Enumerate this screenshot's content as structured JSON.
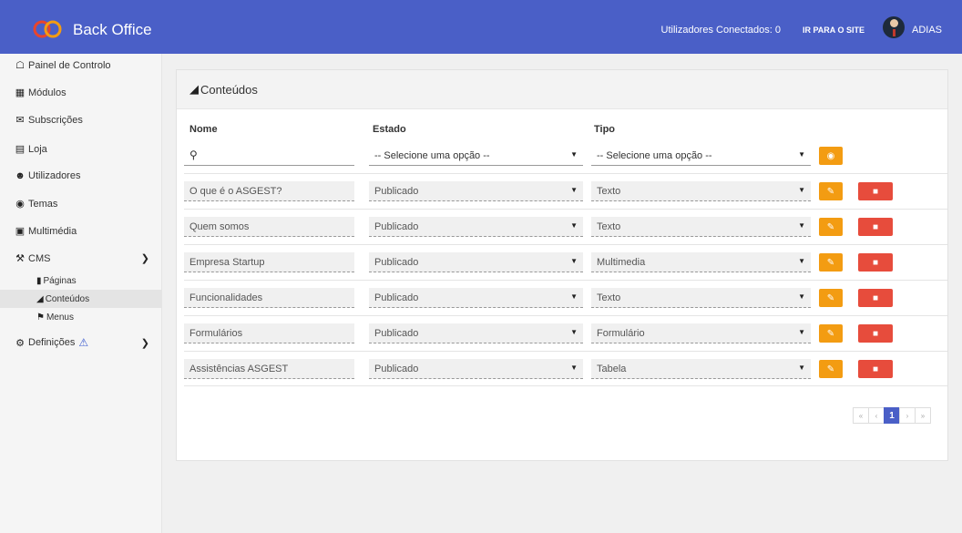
{
  "header": {
    "app_title": "Back Office",
    "connected_users": "Utilizadores Conectados: 0",
    "site_link": "IR PARA O SITE",
    "user_name": "ADIAS"
  },
  "sidebar": {
    "items": [
      {
        "label": "Painel de Controlo",
        "icon": "home-icon"
      },
      {
        "label": "Módulos",
        "icon": "th-large-icon"
      },
      {
        "label": "Subscrições",
        "icon": "envelope-icon"
      },
      {
        "label": "Loja",
        "icon": "cart-icon"
      },
      {
        "label": "Utilizadores",
        "icon": "user-icon"
      },
      {
        "label": "Temas",
        "icon": "tint-icon"
      },
      {
        "label": "Multimédia",
        "icon": "film-icon"
      },
      {
        "label": "CMS",
        "icon": "wrench-icon"
      },
      {
        "label": "Definições",
        "icon": "cog-icon"
      }
    ],
    "cms_sub": [
      {
        "label": "Páginas",
        "icon": "book-icon"
      },
      {
        "label": "Conteúdos",
        "icon": "folder-open-icon",
        "active": true
      },
      {
        "label": "Menus",
        "icon": "bookmark-icon"
      }
    ]
  },
  "panel": {
    "title": "Conteúdos",
    "columns": {
      "nome": "Nome",
      "estado": "Estado",
      "tipo": "Tipo"
    },
    "filters": {
      "search_placeholder": "",
      "estado_select": "-- Selecione uma opção --",
      "tipo_select": "-- Selecione uma opção --"
    },
    "rows": [
      {
        "nome": "O que é o ASGEST?",
        "estado": "Publicado",
        "tipo": "Texto"
      },
      {
        "nome": "Quem somos",
        "estado": "Publicado",
        "tipo": "Texto"
      },
      {
        "nome": "Empresa Startup",
        "estado": "Publicado",
        "tipo": "Multimedia"
      },
      {
        "nome": "Funcionalidades",
        "estado": "Publicado",
        "tipo": "Texto"
      },
      {
        "nome": "Formulários",
        "estado": "Publicado",
        "tipo": "Formulário"
      },
      {
        "nome": "Assistências ASGEST",
        "estado": "Publicado",
        "tipo": "Tabela"
      }
    ],
    "pagination": {
      "first": "«",
      "prev": "‹",
      "current": "1",
      "next": "›",
      "last": "»"
    }
  },
  "colors": {
    "brand": "#4a5fc7",
    "edit": "#f39c12",
    "delete": "#e74c3c"
  }
}
